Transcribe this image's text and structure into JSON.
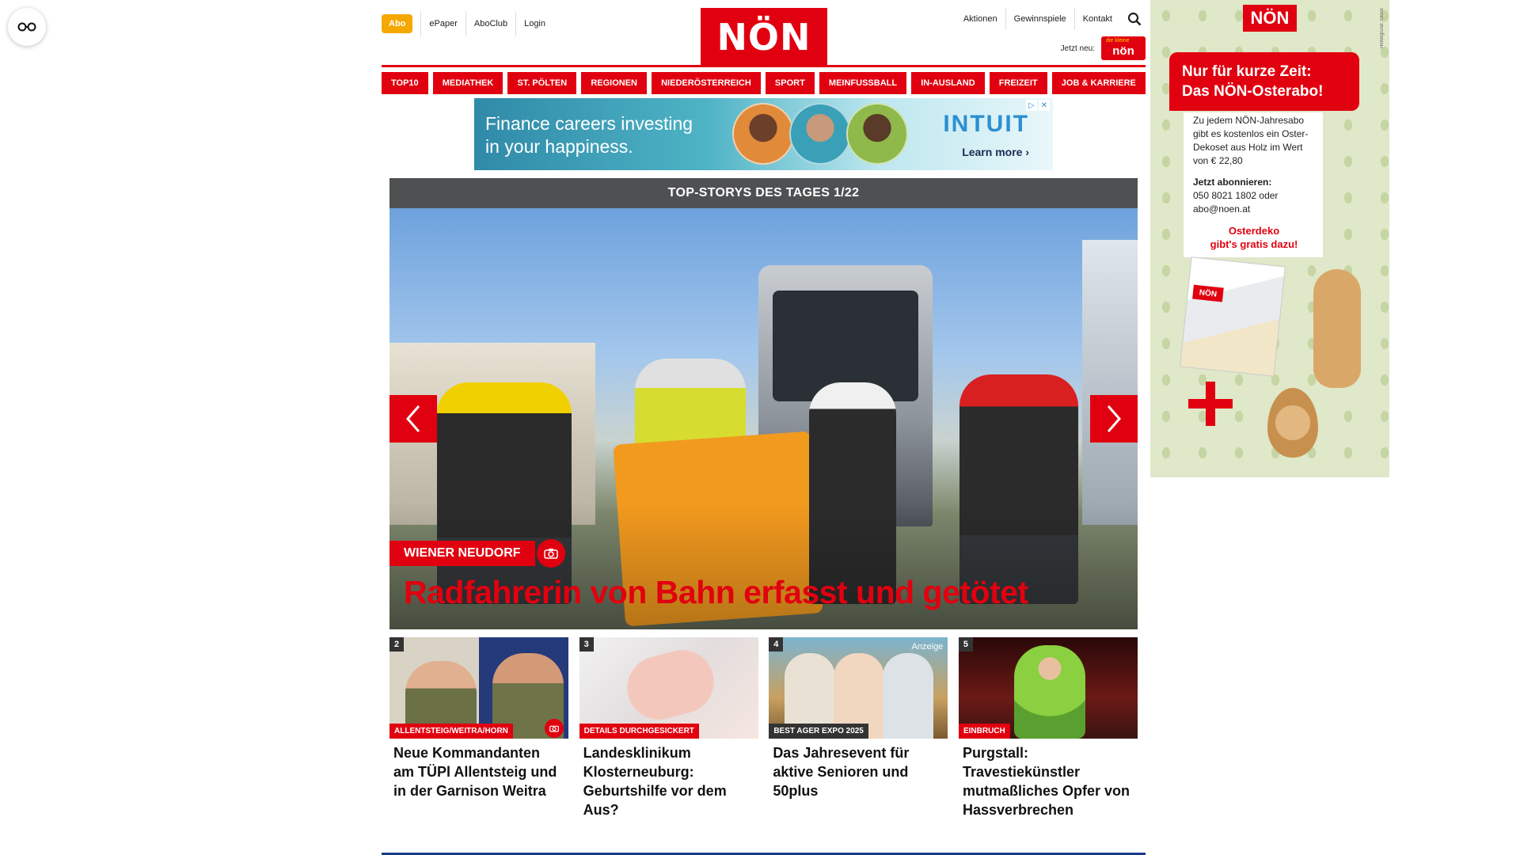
{
  "accessibility": {
    "icon": "glasses-icon"
  },
  "header": {
    "abo_label": "Abo",
    "links_left": [
      "ePaper",
      "AboClub",
      "Login"
    ],
    "logo_text": "NÖN",
    "links_right": [
      "Aktionen",
      "Gewinnspiele",
      "Kontakt"
    ],
    "jetzt_neu_label": "Jetzt neu:",
    "mini_logo_text": "nön",
    "mini_logo_small": "die kleine"
  },
  "nav": {
    "items": [
      "TOP10",
      "MEDIATHEK",
      "ST. PÖLTEN",
      "REGIONEN",
      "NIEDERÖSTERREICH",
      "SPORT",
      "MEINFUSSBALL",
      "IN-AUSLAND",
      "FREIZEIT",
      "JOB & KARRIERE"
    ]
  },
  "ad_banner": {
    "text_line1": "Finance careers investing",
    "text_line2": "in your happiness.",
    "brand": "INTUIT",
    "cta": "Learn more ›"
  },
  "top_stories": {
    "header": "TOP-STORYS DES TAGES 1/22",
    "main": {
      "category": "WIENER NEUDORF",
      "title": "Radfahrerin von Bahn erfasst und getötet"
    },
    "teasers": [
      {
        "num": "2",
        "category": "ALLENTSTEIG/WEITRA/HORN",
        "title": "Neue Kommandanten am TÜPl Allentsteig und in der Garnison Weitra",
        "has_camera": true
      },
      {
        "num": "3",
        "category": "DETAILS DURCHGESICKERT",
        "title": "Landesklinikum Klosterneuburg: Geburtshilfe vor dem Aus?"
      },
      {
        "num": "4",
        "category": "BEST AGER EXPO 2025",
        "title": "Das Jahresevent für aktive Senioren und 50plus",
        "label": "Anzeige"
      },
      {
        "num": "5",
        "category": "EINBRUCH",
        "title": "Purgstall: Travestiekünstler mutmaßliches Opfer von Hassverbrechen"
      }
    ]
  },
  "side_ad": {
    "logo": "NÖN",
    "headline_1": "Nur für kurze Zeit:",
    "headline_2": "Das NÖN-Osterabo!",
    "body_1": "Zu jedem NÖN-Jahresabo gibt es kostenlos ein Oster-Dekoset aus Holz im Wert von € 22,80",
    "body_2_strong": "Jetzt abonnieren:",
    "body_2": "050 8021 1802 oder abo@noen.at",
    "promo_1": "Osterdeko",
    "promo_2": "gibt's gratis dazu!",
    "mag_tag": "NÖN"
  }
}
